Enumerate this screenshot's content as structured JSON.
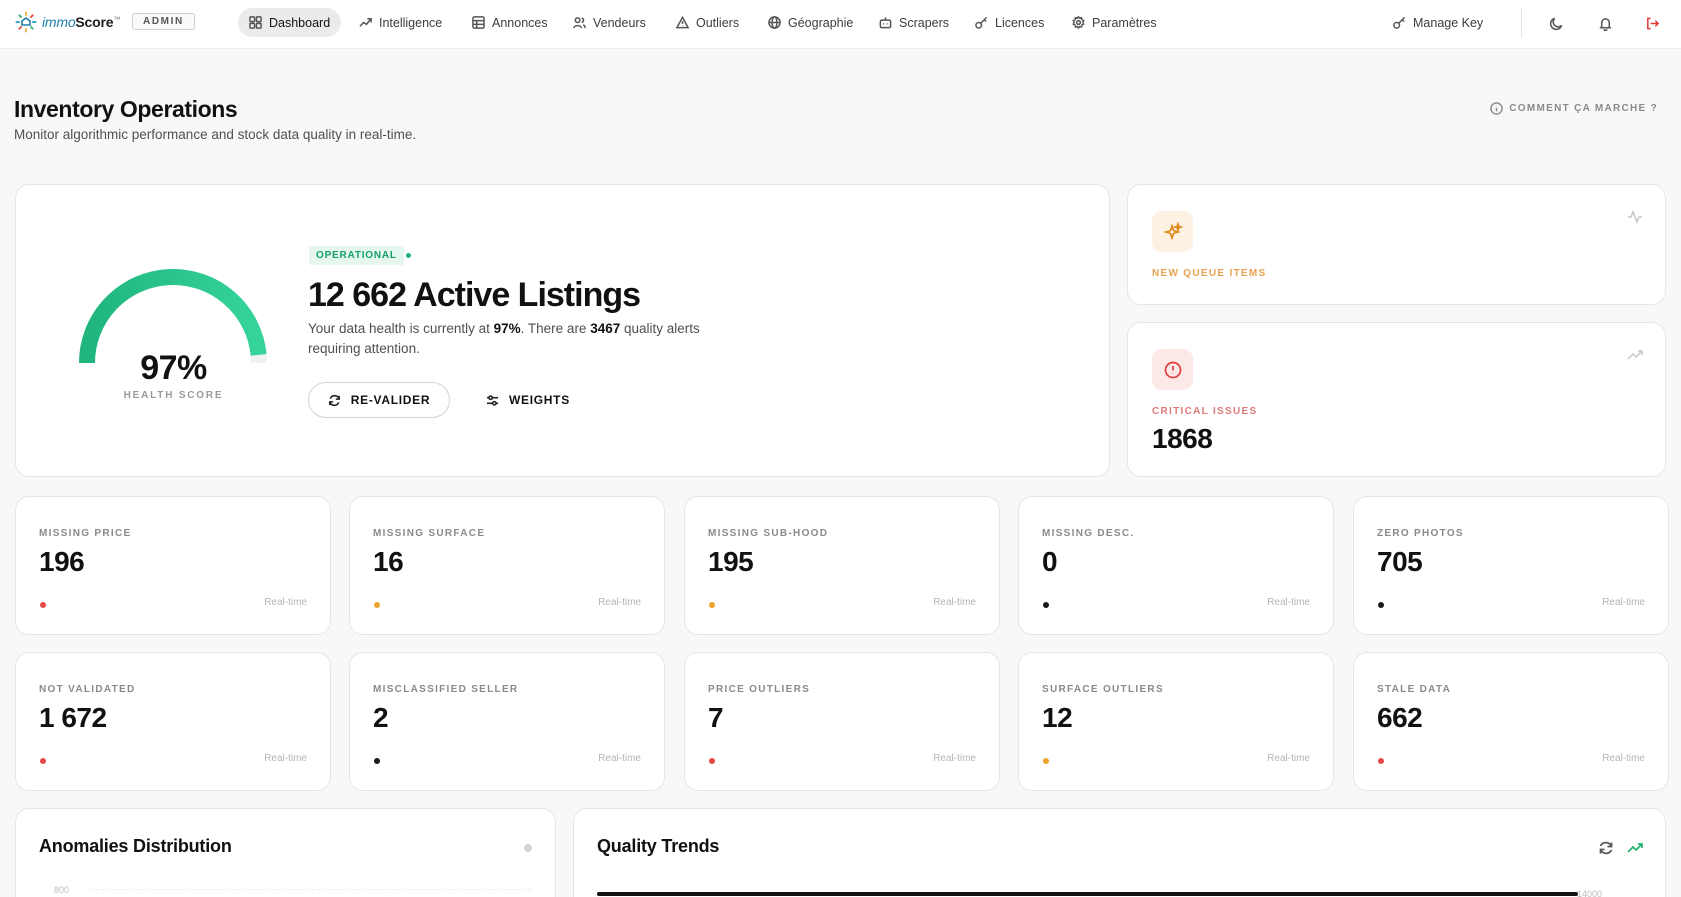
{
  "nav": {
    "brand_prefix": "immo",
    "brand_suffix": "Score",
    "brand_mark": "™",
    "role_badge": "ADMIN",
    "items": [
      {
        "label": "Dashboard",
        "icon": "layout-grid-icon",
        "active": true
      },
      {
        "label": "Intelligence",
        "icon": "trend-up-icon"
      },
      {
        "label": "Annonces",
        "icon": "table-icon"
      },
      {
        "label": "Vendeurs",
        "icon": "users-icon"
      },
      {
        "label": "Outliers",
        "icon": "warning-icon"
      },
      {
        "label": "Géographie",
        "icon": "globe-icon"
      },
      {
        "label": "Scrapers",
        "icon": "bot-icon"
      },
      {
        "label": "Licences",
        "icon": "key-icon"
      },
      {
        "label": "Paramètres",
        "icon": "gear-icon"
      }
    ],
    "manage_key": "Manage Key",
    "theme_icon": "moon-icon",
    "notifications_icon": "bell-icon",
    "logout_icon": "logout-icon",
    "logout_color": "#e23b3b"
  },
  "header": {
    "title": "Inventory Operations",
    "subtitle": "Monitor algorithmic performance and stock data quality in real-time.",
    "help_link": "COMMENT ÇA MARCHE ?"
  },
  "hero": {
    "health_score": "97%",
    "health_score_fraction": 0.97,
    "health_label": "HEALTH SCORE",
    "status": "OPERATIONAL",
    "status_color": "#15a06a",
    "title": "12 662 Active Listings",
    "desc_prefix": "Your data health is currently at ",
    "desc_health": "97%",
    "desc_middle": ". There are ",
    "desc_alerts": "3467",
    "desc_suffix": " quality alerts requiring attention.",
    "revalidate_label": "RE-VALIDER",
    "weights_label": "WEIGHTS"
  },
  "side_cards": {
    "queue": {
      "label": "NEW QUEUE ITEMS",
      "icon": "sparkles-icon",
      "corner_icon": "activity-icon"
    },
    "critical": {
      "label": "CRITICAL ISSUES",
      "value": "1868",
      "icon": "alert-circle-icon",
      "corner_icon": "trend-up-icon"
    }
  },
  "metrics": [
    {
      "label": "MISSING PRICE",
      "value": "196",
      "dot": "#e54848",
      "foot": "Real-time"
    },
    {
      "label": "MISSING SURFACE",
      "value": "16",
      "dot": "#eea32b",
      "foot": "Real-time"
    },
    {
      "label": "MISSING SUB-HOOD",
      "value": "195",
      "dot": "#eea32b",
      "foot": "Real-time"
    },
    {
      "label": "MISSING DESC.",
      "value": "0",
      "dot": "#1a1a1a",
      "foot": "Real-time"
    },
    {
      "label": "ZERO PHOTOS",
      "value": "705",
      "dot": "#1a1a1a",
      "foot": "Real-time"
    },
    {
      "label": "NOT VALIDATED",
      "value": "1 672",
      "dot": "#e54848",
      "foot": "Real-time"
    },
    {
      "label": "MISCLASSIFIED SELLER",
      "value": "2",
      "dot": "#1a1a1a",
      "foot": "Real-time"
    },
    {
      "label": "PRICE OUTLIERS",
      "value": "7",
      "dot": "#e54848",
      "foot": "Real-time"
    },
    {
      "label": "SURFACE OUTLIERS",
      "value": "12",
      "dot": "#eea32b",
      "foot": "Real-time"
    },
    {
      "label": "STALE DATA",
      "value": "662",
      "dot": "#e54848",
      "foot": "Real-time"
    }
  ],
  "anomalies": {
    "title": "Anomalies Distribution",
    "y_tick": "800"
  },
  "trends": {
    "title": "Quality Trends",
    "y_tick": "14000",
    "refresh_icon": "refresh-icon",
    "trend_icon": "trend-up-icon",
    "accent": "#22b573"
  }
}
